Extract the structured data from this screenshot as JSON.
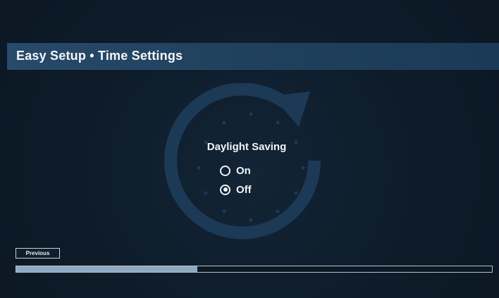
{
  "header": {
    "title": "Easy Setup • Time Settings"
  },
  "clock_icon": "circular-arrow-clock-icon",
  "daylight_saving": {
    "heading": "Daylight Saving",
    "options": [
      {
        "label": "On",
        "selected": false
      },
      {
        "label": "Off",
        "selected": true
      }
    ]
  },
  "footer": {
    "previous_label": "Previous",
    "progress": 0.38
  },
  "colors": {
    "background": "#0d1b28",
    "title_bar": "#21425f",
    "emblem": "#1c3a56",
    "progress_fill": "#8fa9c0",
    "text": "#f2f4f6"
  }
}
